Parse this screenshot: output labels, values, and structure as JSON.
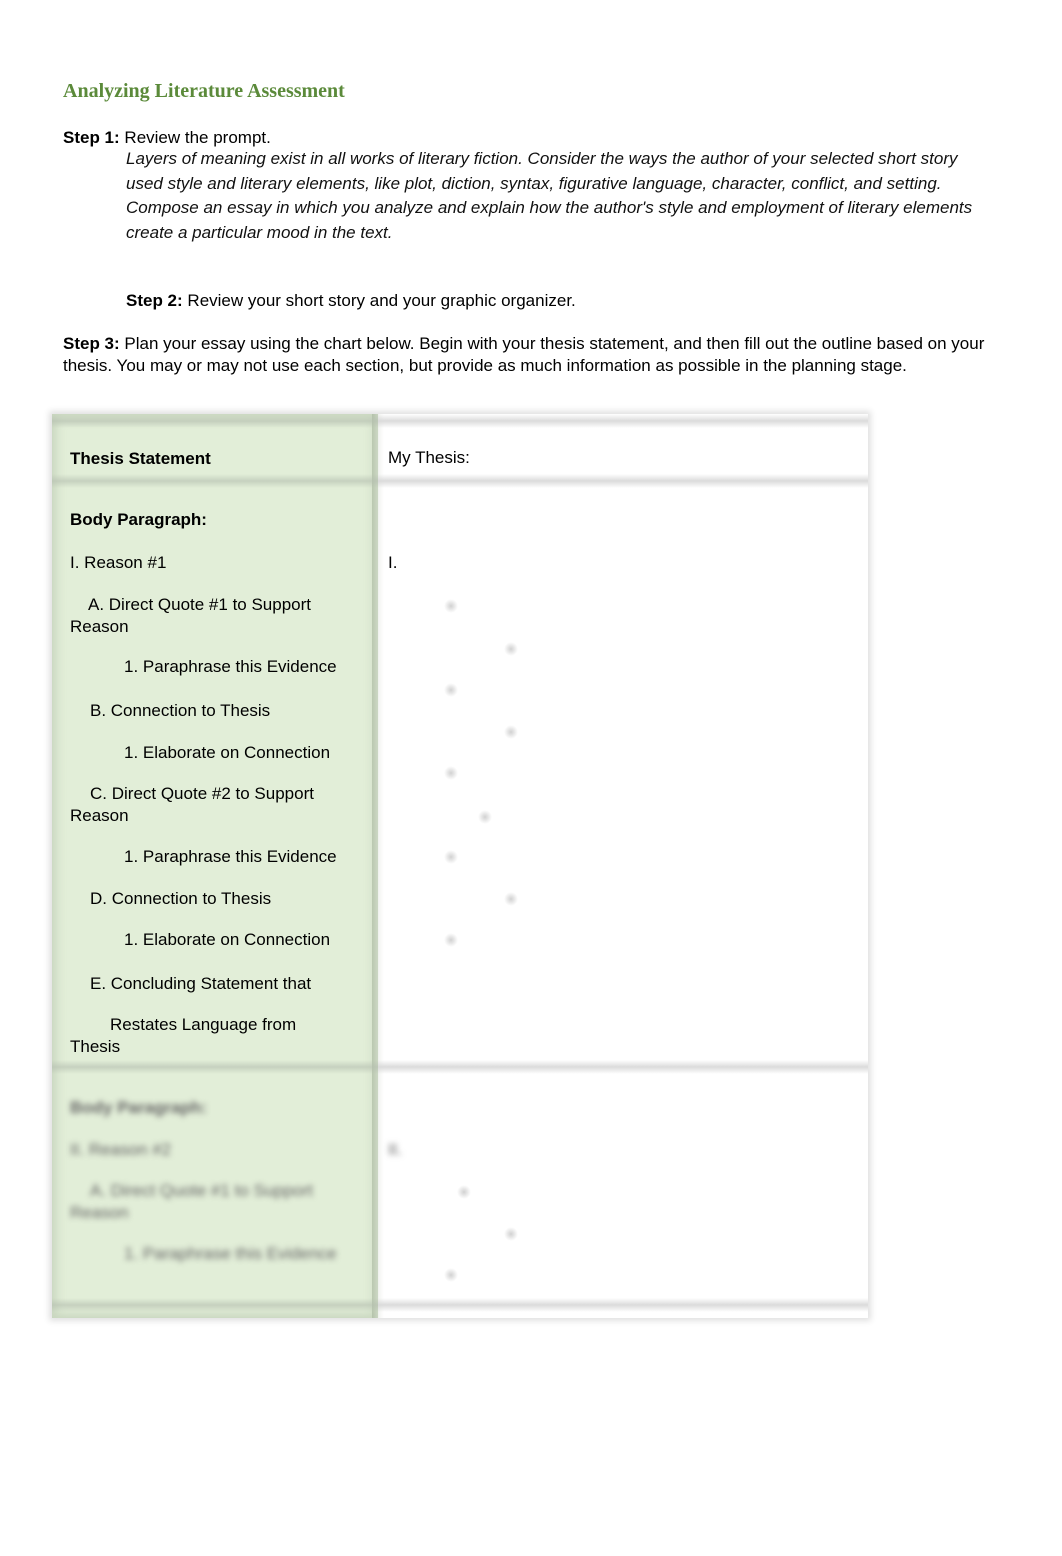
{
  "document": {
    "title": "Analyzing Literature Assessment",
    "step1": {
      "label": "Step 1:",
      "text": " Review the prompt."
    },
    "prompt": "Layers of meaning exist in all works of literary fiction. Consider the ways the author of your selected short story used style and literary elements, like plot, diction, syntax, figurative language, character, conflict, and setting. Compose an essay in which you analyze and explain how the author's style and employment of literary elements create a particular mood in the text.",
    "step2": {
      "label": "Step 2:",
      "text": " Review your short story and your graphic organizer."
    },
    "step3": {
      "label": "Step 3:",
      "text": " Plan your essay using the chart below. Begin with your thesis statement, and then fill out the outline based on your thesis. You may or may not use each section, but provide as much information as possible in the planning stage."
    }
  },
  "outline": {
    "thesis_row": {
      "label": "Thesis Statement",
      "value": "My Thesis:"
    },
    "body1": {
      "heading": "Body Paragraph:",
      "reason": "I. Reason #1",
      "reason_marker": "I.",
      "items": [
        {
          "indent": "A. Direct Quote #1 to Support",
          "cont": "Reason"
        },
        {
          "indent": "1. Paraphrase this Evidence"
        },
        {
          "indent": "B. Connection to Thesis"
        },
        {
          "indent": "1. Elaborate on Connection"
        },
        {
          "indent": "C. Direct Quote #2 to Support",
          "cont": "Reason"
        },
        {
          "indent": "1. Paraphrase this Evidence"
        },
        {
          "indent": "D. Connection to Thesis"
        },
        {
          "indent": "1. Elaborate on Connection"
        },
        {
          "indent": "E. Concluding Statement that"
        },
        {
          "indent": "Restates Language from",
          "cont": "Thesis"
        }
      ]
    },
    "body2": {
      "heading": "Body Paragraph:",
      "reason": "II. Reason #2",
      "reason_marker": "II.",
      "items": [
        {
          "indent": "A. Direct Quote #1 to Support",
          "cont": "Reason"
        },
        {
          "indent": "1. Paraphrase this Evidence"
        }
      ]
    }
  }
}
